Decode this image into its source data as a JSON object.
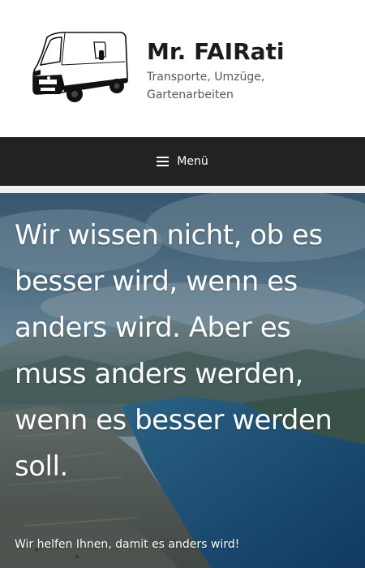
{
  "header": {
    "logo_icon": "van-illustration",
    "title": "Mr. FAIRati",
    "tagline": "Transporte, Umzüge, Gartenarbeiten"
  },
  "nav": {
    "menu_icon": "hamburger-icon",
    "menu_label": "Menü"
  },
  "hero": {
    "background": "mountain-fjord-photo",
    "headline": "Wir wissen nicht, ob es besser wird, wenn es anders wird. Aber es muss anders werden, wenn es besser werden soll.",
    "subline": "Wir helfen Ihnen, damit es anders wird!"
  },
  "colors": {
    "navbar": "#222222",
    "title": "#1b1b1b",
    "tagline": "#595959",
    "hero_text": "#ffffff"
  }
}
